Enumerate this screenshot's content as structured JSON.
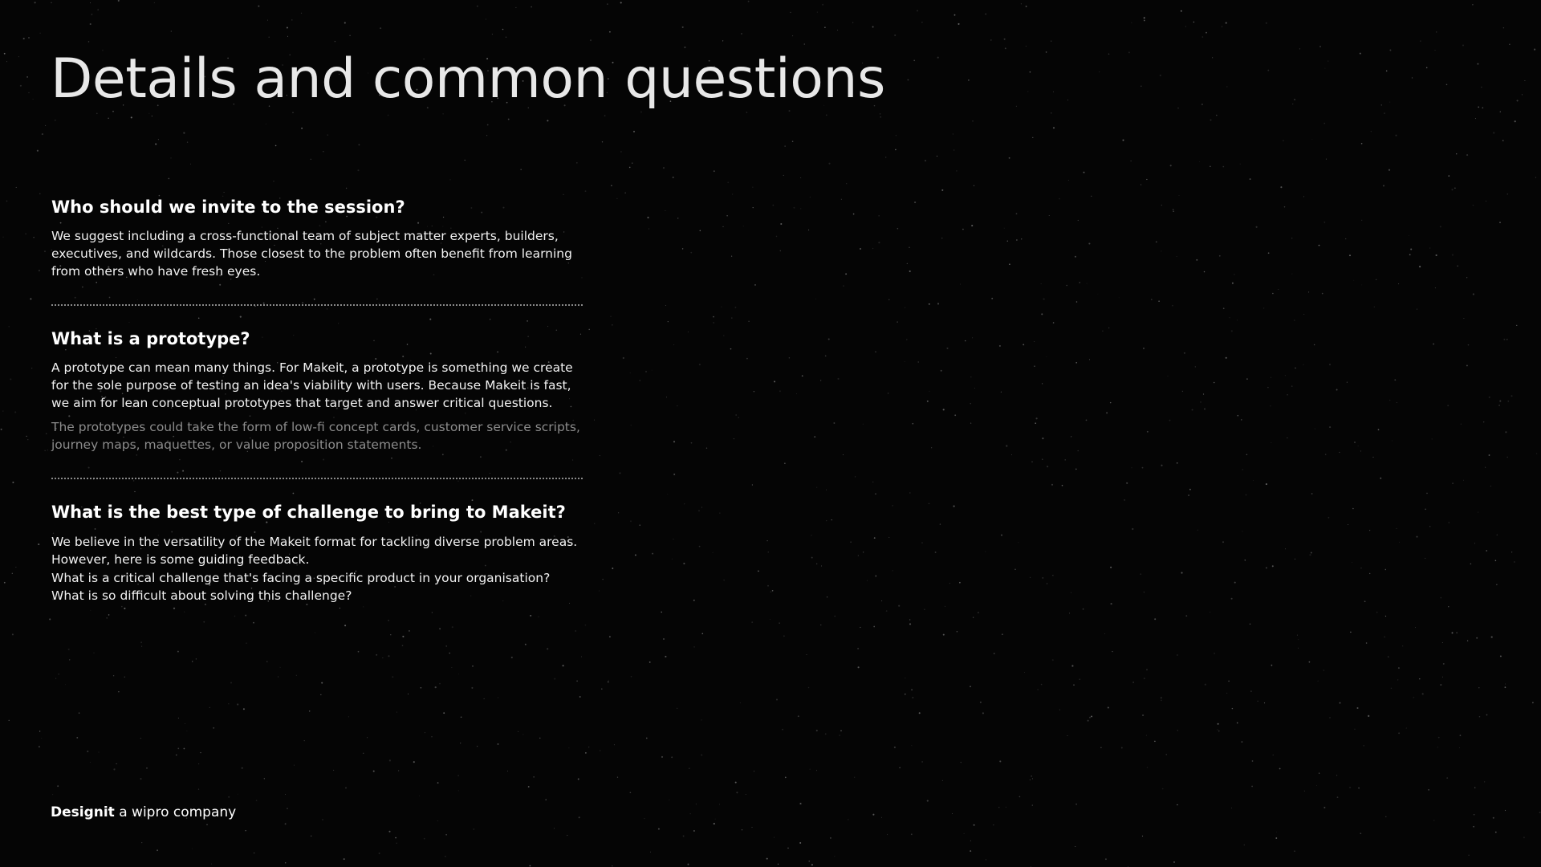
{
  "page": {
    "title": "Details and common questions"
  },
  "faq": [
    {
      "question": "Who should we invite to the session?",
      "paragraphs": [
        "We suggest including a cross-functional team of subject matter experts, builders, executives, and wildcards. Those closest to the problem often benefit from learning from others who have fresh eyes."
      ]
    },
    {
      "question": "What is a prototype?",
      "paragraphs": [
        "A prototype can mean many things. For Makeit, a prototype is something we create for the sole purpose of testing an idea's viability with users. Because Makeit is fast, we aim for lean conceptual prototypes that target and answer critical questions.",
        "The prototypes could take the form of low-fi concept cards, customer service scripts, journey maps, maquettes, or value proposition statements."
      ]
    },
    {
      "question": "What is the best type of challenge to bring to Makeit?",
      "paragraphs": [
        "We believe in the versatility of the Makeit format for tackling diverse problem areas. However, here is some guiding feedback.",
        "What is a critical challenge that's facing a specific product in your organisation? What is so difficult about solving this challenge?"
      ]
    }
  ],
  "footer": {
    "brand": "Designit",
    "tagline": "a wipro company"
  },
  "colors": {
    "background": "#050505",
    "text": "#ffffff",
    "muted_text": "#8c8c8c",
    "divider": "#8a8a8a"
  }
}
